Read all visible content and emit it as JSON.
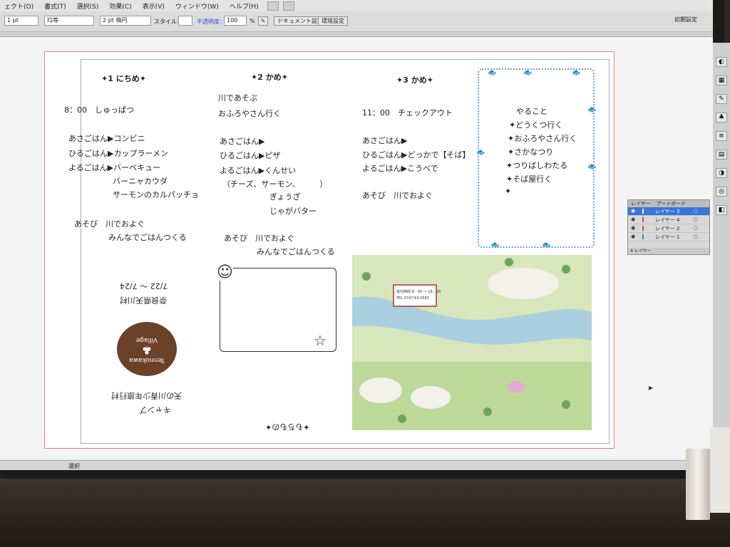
{
  "menu": {
    "items": [
      "ェクト(O)",
      "書式(T)",
      "選択(S)",
      "効果(C)",
      "表示(V)",
      "ウィンドウ(W)",
      "ヘルプ(H)"
    ],
    "workspace": "初期設定"
  },
  "control_bar": {
    "stroke_width": "1 pt",
    "stroke_profile": "均等",
    "brush": "2 pt 楕円",
    "style_label": "スタイル：",
    "opacity_label": "不透明度：",
    "opacity_value": "100",
    "opacity_unit": "%",
    "document_setup_button": "ドキュメント設定",
    "preferences_button": "環境設定"
  },
  "document": {
    "day1": {
      "header": "✦1 にちめ✦",
      "lines": [
        "8：00　しゅっぱつ",
        "あさごはん▶コンビニ",
        "ひるごはん▶カップラーメン",
        "よるごはん▶バーベキュー",
        "バーニャカウダ",
        "サーモンのカルパッチョ",
        "あそび　川でおよぐ",
        "みんなでごはんつくる"
      ]
    },
    "day2": {
      "header": "✦2 かめ✦",
      "lines": [
        "川であそぶ",
        "おふろやさん行く",
        "あさごはん▶",
        "ひるごはん▶ピザ",
        "よるごはん▶くんせい",
        "（チーズ、サーモン、　　　）",
        "ぎょうざ",
        "じゃがバター",
        "あそび　川でおよぐ",
        "みんなでごはんつくる"
      ]
    },
    "day3": {
      "header": "✦3 かめ✦",
      "lines": [
        "11：00　チェックアウト",
        "あさごはん▶",
        "ひるごはん▶どっかで【そば】",
        "よるごはん▶こうべで",
        "あそび　川でおよぐ"
      ]
    },
    "todo": {
      "title": "やること",
      "items": [
        "✦どうくつ行く",
        "✦おふろやさん行く",
        "✦さかなつり",
        "✦つりばしわたる",
        "✦そば屋行く",
        "✦"
      ]
    },
    "flipped": {
      "dates": "7/22 ～ 7/24",
      "place": "奈良県天川村",
      "camp_title": "キャンプ",
      "camp_subtitle": "天の川青少年旅行村",
      "belongings": "✦もちもの✦"
    },
    "logo": {
      "line1": "Tennokawa",
      "line2": "Village"
    },
    "map_sign": {
      "line1": "受付時間 8：00 ～ 18：00",
      "line2": "TEL 0747-63-0555"
    }
  },
  "layers_panel": {
    "tab1": "レイヤー",
    "tab2": "アートボード",
    "layers": [
      {
        "name": "レイヤー 3",
        "color": "#4c7fd8",
        "selected": true
      },
      {
        "name": "レイヤー 4",
        "color": "#d84c4c",
        "selected": false
      },
      {
        "name": "レイヤー 2",
        "color": "#d84c4c",
        "selected": false
      },
      {
        "name": "レイヤー 1",
        "color": "#4c7fd8",
        "selected": false
      }
    ],
    "footer": "4 レイヤー"
  },
  "status": {
    "zoom": "",
    "label": "選択"
  }
}
